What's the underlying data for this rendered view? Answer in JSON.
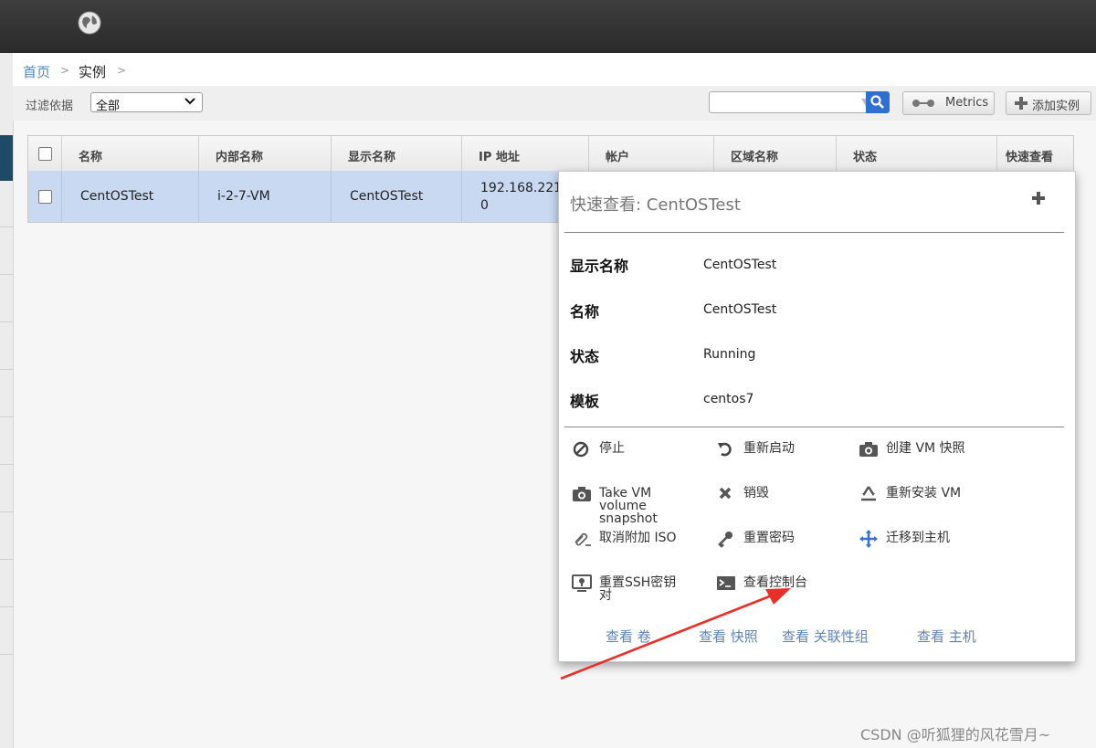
{
  "breadcrumb": {
    "home": "首页",
    "sep": ">",
    "current": "实例"
  },
  "filter": {
    "label": "过滤依据",
    "selected": "全部"
  },
  "search": {
    "value": ""
  },
  "toolbar": {
    "metrics_label": "Metrics",
    "add_label": "添加实例"
  },
  "table": {
    "headers": [
      "名称",
      "内部名称",
      "显示名称",
      "IP 地址",
      "帐户",
      "区域名称",
      "状态",
      "快速查看"
    ],
    "rows": [
      {
        "name": "CentOSTest",
        "internal": "i-2-7-VM",
        "display": "CentOSTest",
        "ip_line1": "192.168.221.",
        "ip_line2": "0"
      }
    ]
  },
  "quickview": {
    "title": "快速查看: CentOSTest",
    "fields": [
      {
        "label": "显示名称",
        "value": "CentOSTest"
      },
      {
        "label": "名称",
        "value": "CentOSTest"
      },
      {
        "label": "状态",
        "value": "Running"
      },
      {
        "label": "模板",
        "value": "centos7"
      }
    ],
    "actions": [
      {
        "label": "停止",
        "icon": "stop-icon"
      },
      {
        "label": "重新启动",
        "icon": "restart-icon"
      },
      {
        "label": "创建 VM 快照",
        "icon": "camera-icon"
      },
      {
        "label": "Take VM volume snapshot",
        "line1": "Take VM",
        "line2": "volume",
        "line3": "snapshot",
        "icon": "camera-icon"
      },
      {
        "label": "销毁",
        "icon": "close-icon"
      },
      {
        "label": "重新安装 VM",
        "icon": "recycle-icon"
      },
      {
        "label": "取消附加 ISO",
        "icon": "paperclip-icon"
      },
      {
        "label": "重置密码",
        "icon": "key-icon"
      },
      {
        "label": "迁移到主机",
        "icon": "move-icon"
      },
      {
        "label": "重置SSH密钥对",
        "line1": "重置SSH密钥",
        "line2": "对",
        "icon": "ssh-key-icon"
      },
      {
        "label": "查看控制台",
        "icon": "console-icon"
      }
    ],
    "links": [
      "查看 卷",
      "查看 快照",
      "查看 关联性组",
      "查看 主机"
    ]
  },
  "watermark": "CSDN @听狐狸的风花雪月~"
}
